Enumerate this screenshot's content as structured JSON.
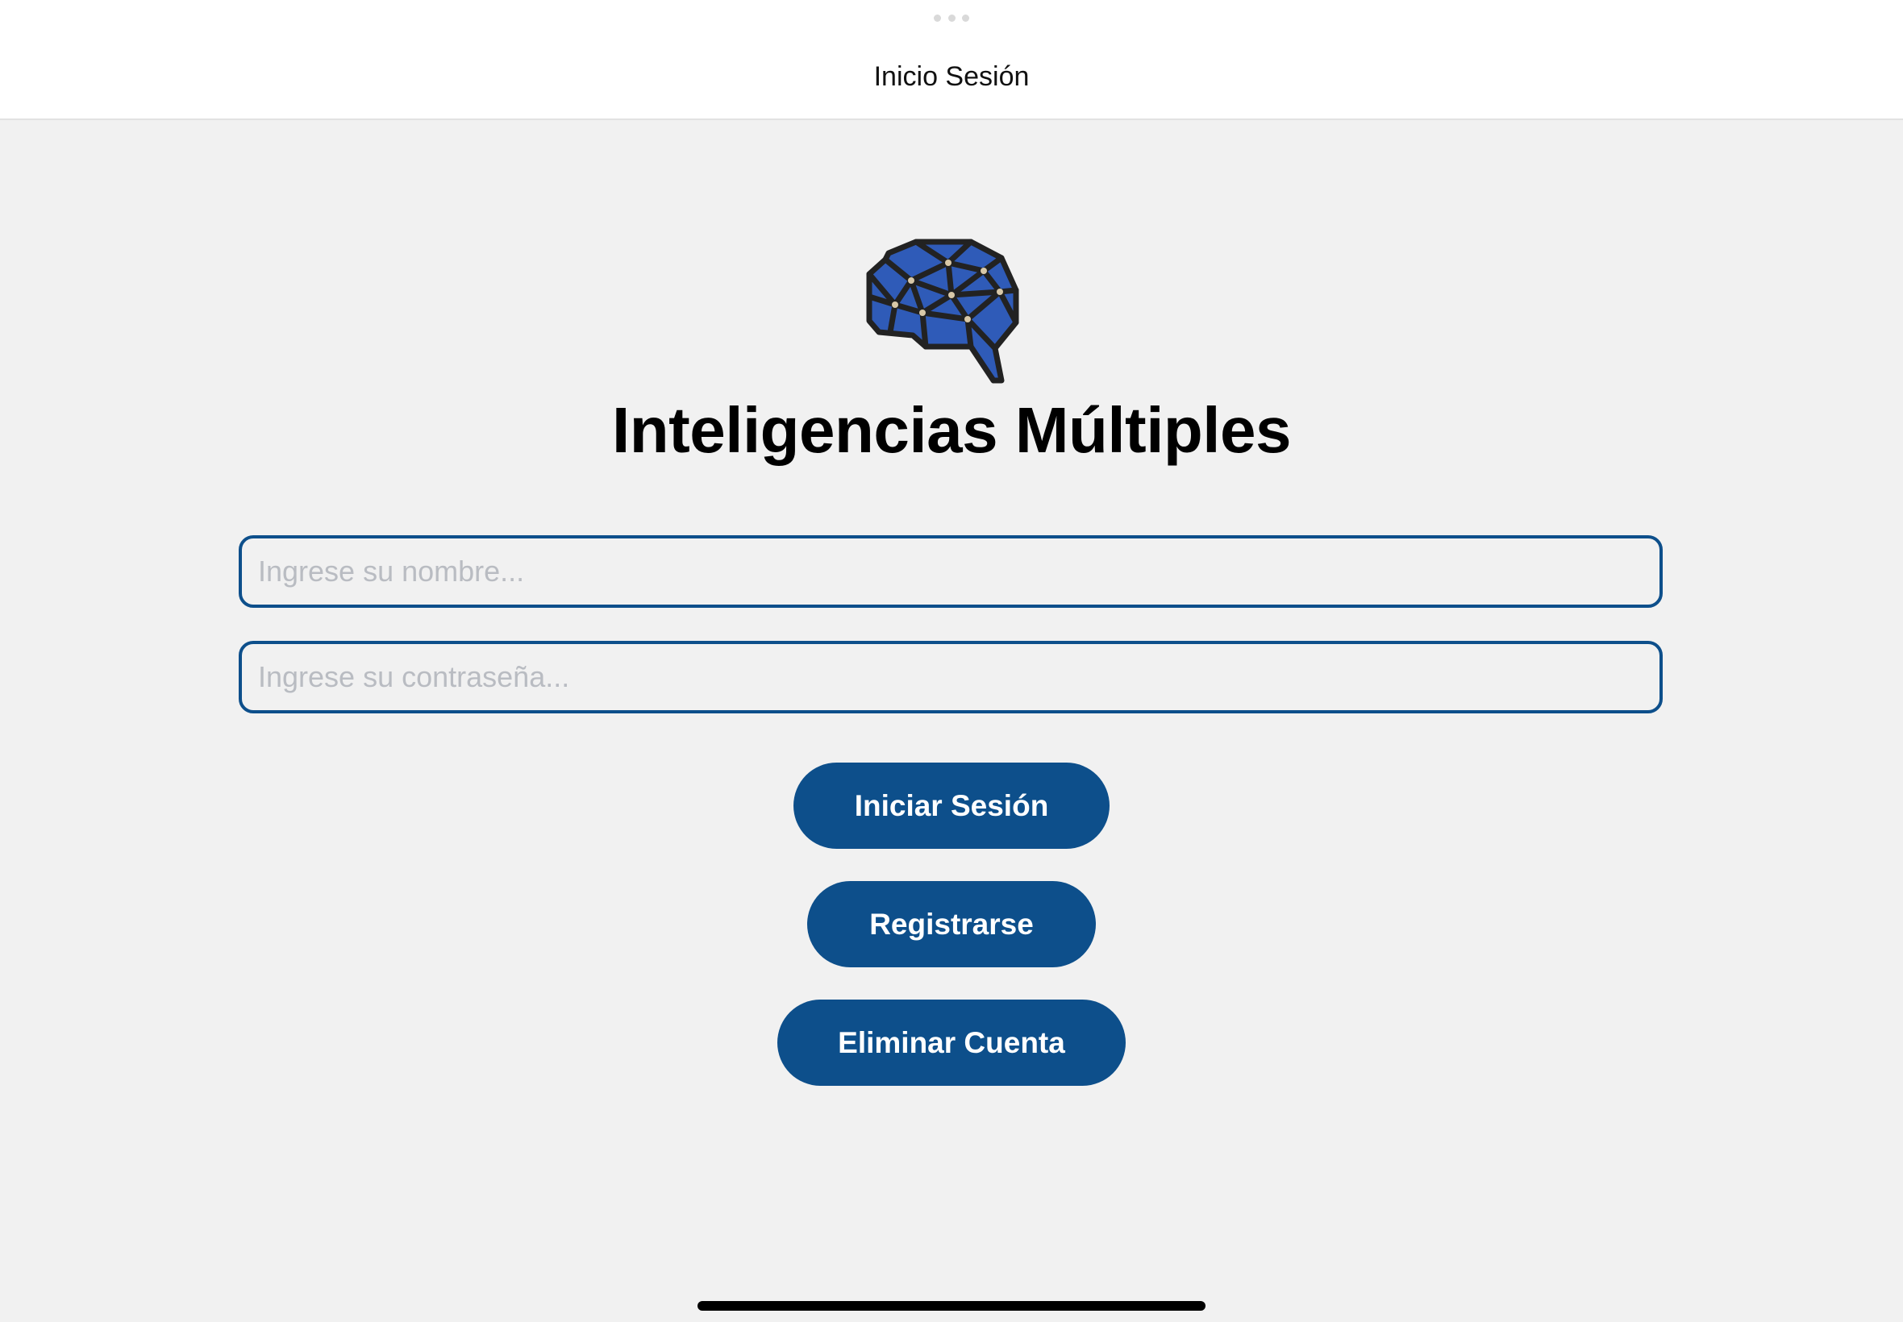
{
  "navbar": {
    "title": "Inicio Sesión"
  },
  "logo": {
    "icon": "brain-network-icon",
    "fill_color": "#2f5bb8",
    "stroke_color": "#222222"
  },
  "app": {
    "title": "Inteligencias Múltiples"
  },
  "form": {
    "name_field": {
      "value": "",
      "placeholder": "Ingrese su nombre..."
    },
    "password_field": {
      "value": "",
      "placeholder": "Ingrese su contraseña..."
    }
  },
  "buttons": {
    "login_label": "Iniciar Sesión",
    "register_label": "Registrarse",
    "delete_label": "Eliminar Cuenta"
  },
  "colors": {
    "accent": "#0d4f8b",
    "background": "#f1f1f1",
    "placeholder": "#b9bcc2"
  }
}
